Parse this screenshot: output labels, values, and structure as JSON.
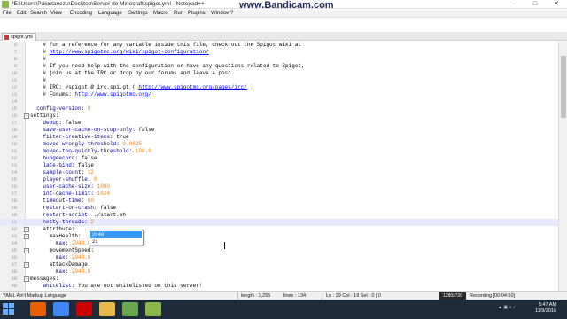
{
  "window": {
    "title": "*E:\\Users\\Pakistanezu\\Desktop\\Server de Minecraft\\spigot.yml - Notepad++",
    "watermark": "www.Bandicam.com",
    "watermark_res": "",
    "minimize": "—",
    "maximize": "□",
    "close": "✕"
  },
  "menu": {
    "items": [
      "File",
      "Edit",
      "Search",
      "View",
      "Encoding",
      "Language",
      "Settings",
      "Macro",
      "Run",
      "Plugins",
      "Window",
      "?"
    ]
  },
  "tab": {
    "label": "spigot.yml"
  },
  "editor": {
    "lines": [
      {
        "n": "6",
        "t": "    # for a reference for any variable inside this file, check out the Spigot wiki at",
        "k": "comment"
      },
      {
        "n": "7",
        "t": "    # http://www.spigotmc.org/wiki/spigot-configuration/",
        "k": "commentlink"
      },
      {
        "n": "8",
        "t": "    #",
        "k": "comment"
      },
      {
        "n": "9",
        "t": "    # If you need help with the configuration or have any questions related to Spigot,",
        "k": "comment"
      },
      {
        "n": "10",
        "t": "    # join us at the IRC or drop by our forums and leave a post.",
        "k": "comment"
      },
      {
        "n": "11",
        "t": "    #",
        "k": "comment"
      },
      {
        "n": "12",
        "t": "    # IRC: #spigot @ irc.spi.gt ( http://www.spigotmc.org/pages/irc/ )",
        "k": "commentlink"
      },
      {
        "n": "13",
        "t": "    # Forums: http://www.spigotmc.org/",
        "k": "commentlink"
      },
      {
        "n": "14",
        "t": "",
        "k": "plain"
      },
      {
        "n": "15",
        "t": "  config-version: 8",
        "k": "kv"
      },
      {
        "n": "16",
        "t": "settings:",
        "k": "section",
        "fold": true
      },
      {
        "n": "17",
        "t": "    debug: false",
        "k": "kv"
      },
      {
        "n": "18",
        "t": "    save-user-cache-on-stop-only: false",
        "k": "kv"
      },
      {
        "n": "19",
        "t": "    filter-creative-items: true",
        "k": "kv"
      },
      {
        "n": "20",
        "t": "    moved-wrongly-threshold: 0.0625",
        "k": "kv"
      },
      {
        "n": "21",
        "t": "    moved-too-quickly-threshold: 100.0",
        "k": "kv"
      },
      {
        "n": "22",
        "t": "    bungeecord: false",
        "k": "kv"
      },
      {
        "n": "23",
        "t": "    late-bind: false",
        "k": "kv"
      },
      {
        "n": "24",
        "t": "    sample-count: 12",
        "k": "kv"
      },
      {
        "n": "25",
        "t": "    player-shuffle: 0",
        "k": "kv"
      },
      {
        "n": "26",
        "t": "    user-cache-size: 1000",
        "k": "kv"
      },
      {
        "n": "27",
        "t": "    int-cache-limit: 1024",
        "k": "kv"
      },
      {
        "n": "28",
        "t": "    timeout-time: 60",
        "k": "kv"
      },
      {
        "n": "29",
        "t": "    restart-on-crash: false",
        "k": "kv"
      },
      {
        "n": "30",
        "t": "    restart-script: ./start.sh",
        "k": "kv"
      },
      {
        "n": "31",
        "t": "    netty-threads: 2",
        "k": "kv",
        "hl": true
      },
      {
        "n": "32",
        "t": "    attribute:",
        "k": "section",
        "fold": true
      },
      {
        "n": "33",
        "t": "      maxHealth:",
        "k": "section",
        "fold": true
      },
      {
        "n": "34",
        "t": "        max: 2048.0",
        "k": "kv"
      },
      {
        "n": "35",
        "t": "      movementSpeed:",
        "k": "section",
        "fold": true
      },
      {
        "n": "36",
        "t": "        max: 2048.0",
        "k": "kv"
      },
      {
        "n": "37",
        "t": "      attackDamage:",
        "k": "section",
        "fold": true
      },
      {
        "n": "38",
        "t": "        max: 2048.0",
        "k": "kv"
      },
      {
        "n": "39",
        "t": "messages:",
        "k": "section",
        "fold": true
      },
      {
        "n": "40",
        "t": "    whitelist: You are not whitelisted on this server!",
        "k": "kv"
      }
    ]
  },
  "autocomplete": {
    "items": [
      "2048",
      "21"
    ],
    "selected_index": 0
  },
  "status": {
    "language": "YAML Ain't Markup Language",
    "length": "length : 3,255",
    "lines": "lines : 134",
    "position": "Ln : 29   Col : 19   Sel : 0 | 0",
    "rec_badge": "1280x720",
    "recording": "Recording [00:04:50]"
  },
  "taskbar": {
    "clock_time": "5:47 AM",
    "clock_date": "11/9/2016",
    "apps": [
      {
        "icon": "firefox-icon",
        "color": "#e66000"
      },
      {
        "icon": "chrome-icon",
        "color": "#4285f4"
      },
      {
        "icon": "record-icon",
        "color": "#cc0000"
      },
      {
        "icon": "folder-icon",
        "color": "#e8b84a"
      },
      {
        "icon": "minecraft-icon",
        "color": "#6aa84f"
      },
      {
        "icon": "notepad-icon",
        "color": "#8bb84a"
      }
    ]
  },
  "colors": {
    "comment": "#008000",
    "link": "#0000ee",
    "number": "#ff8000",
    "selection": "#3399ff"
  }
}
